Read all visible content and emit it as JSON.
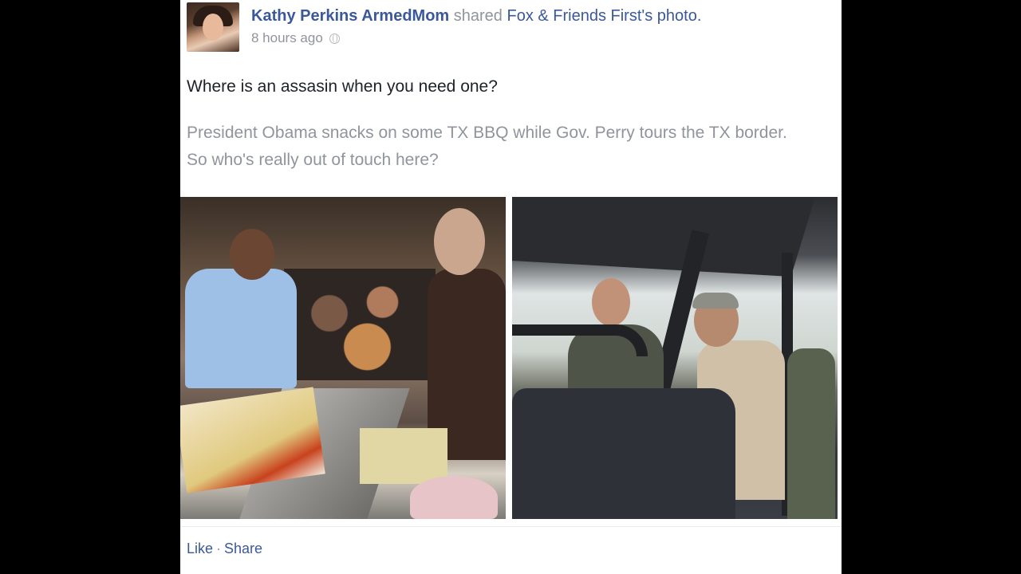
{
  "post": {
    "author": "Kathy Perkins ArmedMom",
    "action_text": " shared ",
    "source_page": "Fox & Friends First's",
    "object_text": " photo.",
    "timestamp": "8 hours ago",
    "privacy_icon": "globe-icon",
    "status": "Where is an assasin when you need one?",
    "caption": "President Obama snacks on some TX BBQ while Gov. Perry tours the TX border. So who's really out of touch here?"
  },
  "actions": {
    "like_label": "Like",
    "separator": "·",
    "share_label": "Share"
  },
  "colors": {
    "link": "#3b5998",
    "meta": "#90949c",
    "text": "#1d2129",
    "background": "#000000"
  }
}
